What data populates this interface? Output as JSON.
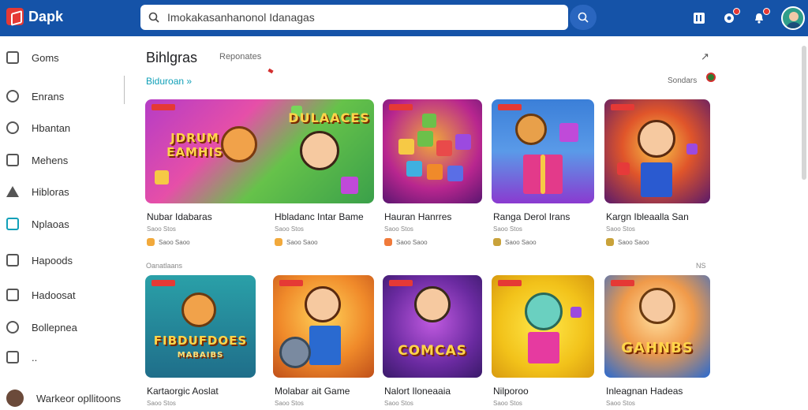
{
  "app": {
    "name": "Dapk"
  },
  "search": {
    "value": "Imokakasanhanonol Idanagas"
  },
  "sidebar": {
    "items": [
      {
        "label": "Goms",
        "icon": "box-icon"
      },
      {
        "label": "Enrans",
        "icon": "person-icon"
      },
      {
        "label": "Hbantan",
        "icon": "shield-icon"
      },
      {
        "label": "Mehens",
        "icon": "checkbox-icon"
      },
      {
        "label": "Hibloras",
        "icon": "warning-icon"
      },
      {
        "label": "Nplaoas",
        "icon": "tv-icon"
      },
      {
        "label": "Hapoods",
        "icon": "home-icon"
      },
      {
        "label": "Hadoosat",
        "icon": "card-icon"
      },
      {
        "label": "Bollepnea",
        "icon": "gear-icon"
      },
      {
        "label": "..",
        "icon": "list-icon"
      },
      {
        "label": "Warkeor opllitoons",
        "icon": "avatar"
      }
    ]
  },
  "main": {
    "title": "Bihlgras",
    "subtitle": "Reponates",
    "section_label": "Biduroan »",
    "sort_label": "Sondars",
    "row2_label": "Oanatlaans",
    "row2_count": "NS",
    "row1": [
      {
        "name": "Nubar Idabaras",
        "meta": "Saoo Stos",
        "rating": "Saoo Saoo",
        "thumb_title": "JDRUM EAMHIS",
        "theme": "purple"
      },
      {
        "name": "Hbladanc Intar Bame",
        "meta": "Saoo Stos",
        "rating": "Saoo Saoo",
        "thumb_title": "DULAACES",
        "theme": "green"
      },
      {
        "name": "Hauran Hanrres",
        "meta": "Saoo Stos",
        "rating": "Saoo Saoo",
        "thumb_title": "",
        "theme": "blocks"
      },
      {
        "name": "Ranga Derol Irans",
        "meta": "Saoo Stos",
        "rating": "Saoo Saoo",
        "thumb_title": "",
        "theme": "gift"
      },
      {
        "name": "Kargn Ibleaalla San",
        "meta": "Saoo Stos",
        "rating": "Saoo Saoo",
        "thumb_title": "",
        "theme": "hero"
      }
    ],
    "row2": [
      {
        "name": "Kartaorgic Aoslat",
        "meta": "Saoo Stos",
        "thumb_title": "FIBDUFDOES",
        "thumb_sub": "MABAIBS",
        "theme": "teal"
      },
      {
        "name": "Molabar ait Game",
        "meta": "Saoo Stos",
        "thumb_title": "",
        "theme": "orange"
      },
      {
        "name": "Nalort Iloneaaia",
        "meta": "Saoo Stos",
        "thumb_title": "COMCAS",
        "theme": "violet"
      },
      {
        "name": "Nilporoo",
        "meta": "Saoo Stos",
        "thumb_title": "",
        "theme": "yellow"
      },
      {
        "name": "Inleagnan Hadeas",
        "meta": "Saoo Stos",
        "thumb_title": "GAHNBS",
        "theme": "sky"
      }
    ]
  },
  "colors": {
    "topbar": "#1553a8",
    "accent": "#11a0b8",
    "badge": "#e53935"
  }
}
